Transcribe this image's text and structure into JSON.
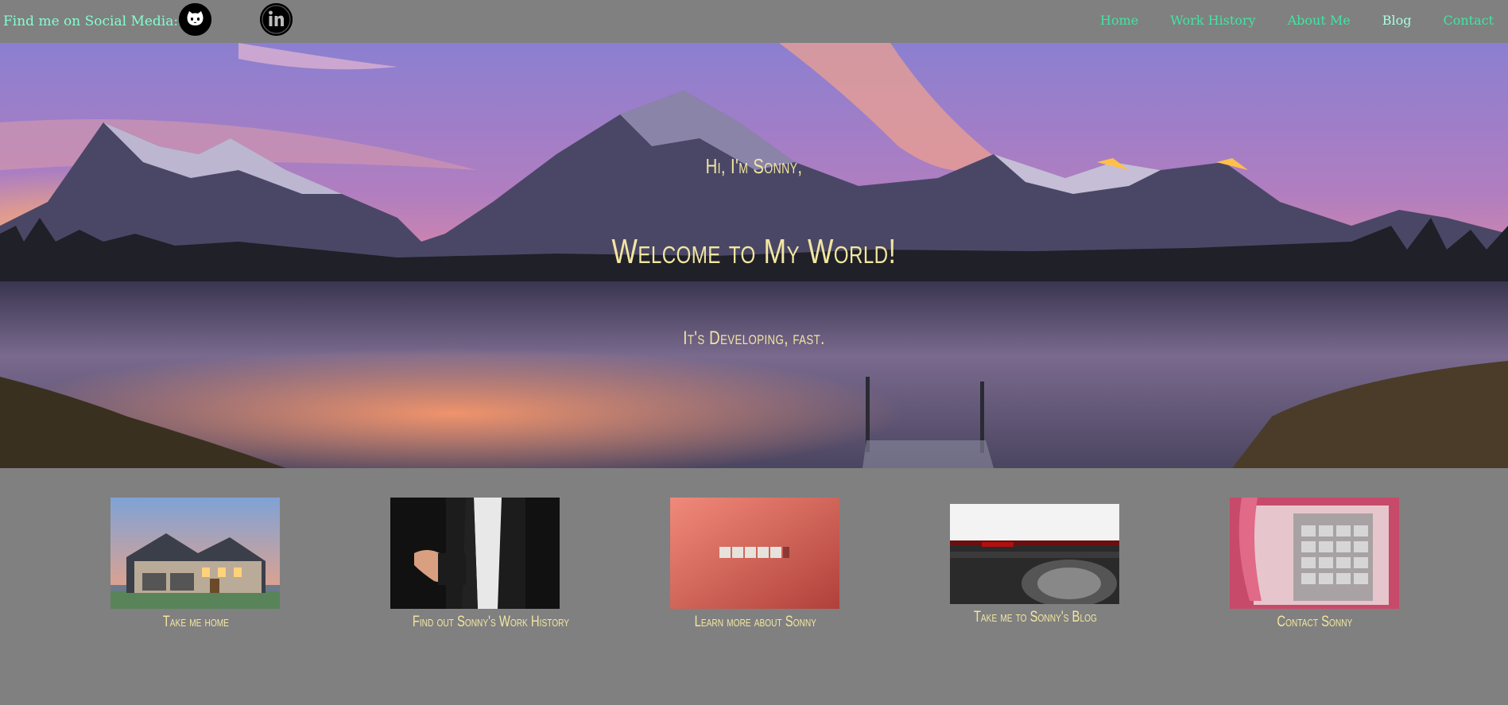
{
  "header": {
    "social_label": "Find me on Social Media:",
    "social_icons": [
      "github-icon",
      "linkedin-icon"
    ]
  },
  "nav": {
    "items": [
      {
        "label": "Home"
      },
      {
        "label": "Work History"
      },
      {
        "label": "About Me"
      },
      {
        "label": "Blog"
      },
      {
        "label": "Contact"
      }
    ]
  },
  "hero": {
    "greeting": "Hi, I'm Sonny,",
    "title": "Welcome to My World!",
    "subtitle": "It's Developing, fast."
  },
  "cards": [
    {
      "caption": "Take me home",
      "image": "house-image"
    },
    {
      "caption": "Find out Sonny's Work History",
      "image": "handshake-image"
    },
    {
      "caption": "Learn more about Sonny",
      "image": "about-tiles-image"
    },
    {
      "caption": "Take me to Sonny's Blog",
      "image": "typewriter-image"
    },
    {
      "caption": "Contact Sonny",
      "image": "payphone-image"
    }
  ],
  "colors": {
    "background": "#808080",
    "nav_link": "#3ee6a3",
    "nav_active": "#a8ffe0",
    "social_label": "#80ffd0",
    "hero_text": "#f2e6a0",
    "caption": "#f2e6a0"
  }
}
